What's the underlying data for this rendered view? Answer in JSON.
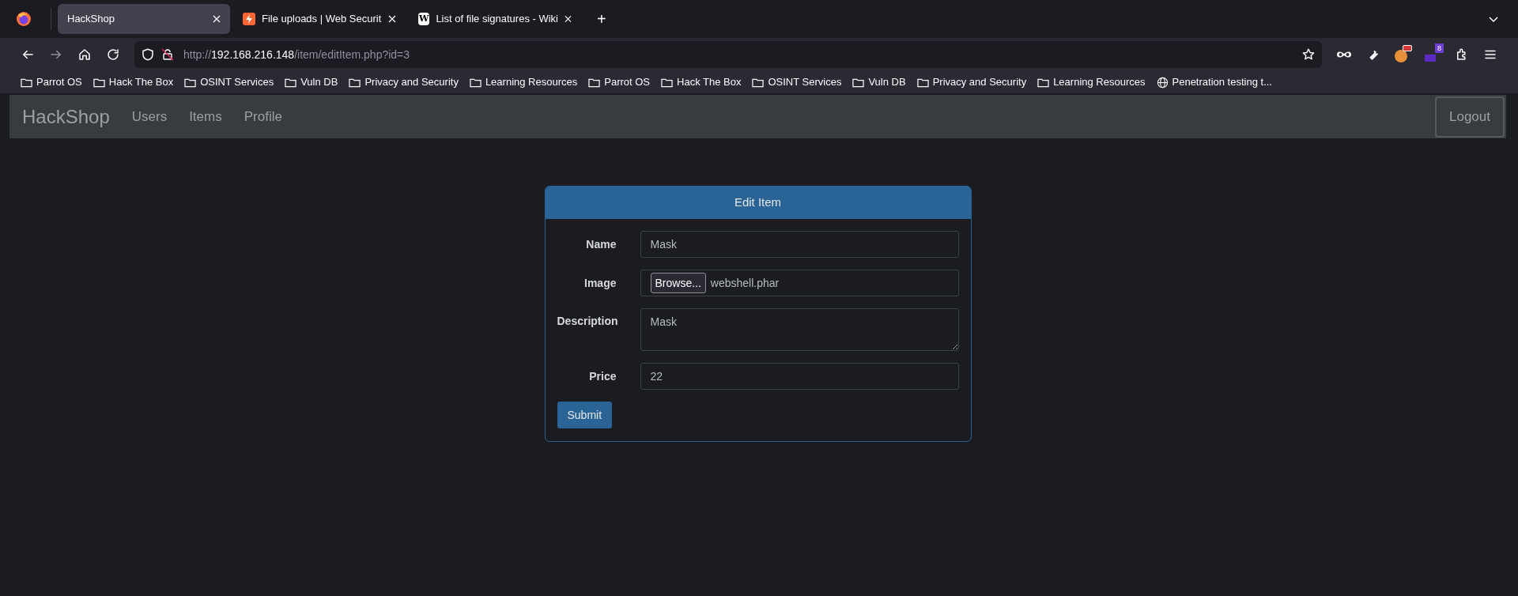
{
  "tabs": [
    {
      "title": "HackShop",
      "selected": true,
      "kind": "plain"
    },
    {
      "title": "File uploads | Web Securit",
      "selected": false,
      "kind": "bolt"
    },
    {
      "title": "List of file signatures - Wiki",
      "selected": false,
      "kind": "wiki",
      "icon_letter": "W"
    }
  ],
  "new_tab": "+",
  "address": {
    "scheme": "http://",
    "host": "192.168.216.148",
    "path": "/item/editItem.php?id=3"
  },
  "extension_badge": "8",
  "bookmarks": [
    {
      "label": "Parrot OS",
      "kind": "folder"
    },
    {
      "label": "Hack The Box",
      "kind": "folder"
    },
    {
      "label": "OSINT Services",
      "kind": "folder"
    },
    {
      "label": "Vuln DB",
      "kind": "folder"
    },
    {
      "label": "Privacy and Security",
      "kind": "folder"
    },
    {
      "label": "Learning Resources",
      "kind": "folder"
    },
    {
      "label": "Parrot OS",
      "kind": "folder"
    },
    {
      "label": "Hack The Box",
      "kind": "folder"
    },
    {
      "label": "OSINT Services",
      "kind": "folder"
    },
    {
      "label": "Vuln DB",
      "kind": "folder"
    },
    {
      "label": "Privacy and Security",
      "kind": "folder"
    },
    {
      "label": "Learning Resources",
      "kind": "folder"
    },
    {
      "label": "Penetration testing t...",
      "kind": "globe"
    }
  ],
  "navbar": {
    "brand": "HackShop",
    "links": [
      "Users",
      "Items",
      "Profile"
    ],
    "logout": "Logout"
  },
  "form": {
    "title": "Edit Item",
    "fields": [
      {
        "label": "Name",
        "kind": "text",
        "value": "Mask"
      },
      {
        "label": "Image",
        "kind": "file",
        "button": "Browse...",
        "value": "webshell.phar"
      },
      {
        "label": "Description",
        "kind": "textarea",
        "value": "Mask"
      },
      {
        "label": "Price",
        "kind": "text",
        "value": "22"
      }
    ],
    "submit": "Submit"
  }
}
